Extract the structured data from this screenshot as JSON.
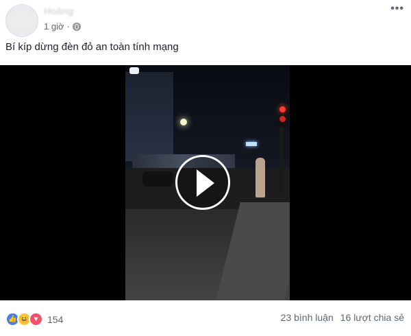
{
  "post": {
    "author": "Hoàng",
    "time": "1 giờ",
    "caption": "Bí kíp dừng đèn đỏ an toàn tính mạng",
    "menu_icon": "•••"
  },
  "reactions": {
    "count": "154",
    "icons": [
      "like-icon",
      "haha-icon",
      "love-icon"
    ]
  },
  "stats": {
    "comments": "23 bình luận",
    "shares": "16 lượt chia sẻ"
  }
}
